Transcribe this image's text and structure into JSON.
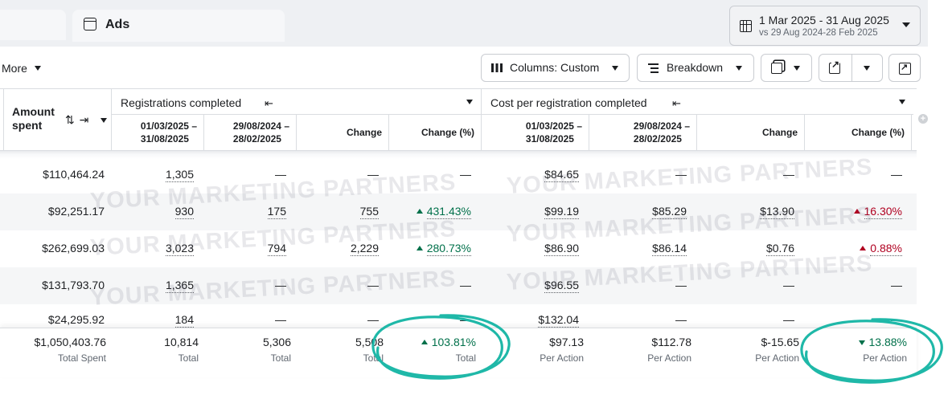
{
  "header": {
    "tab_ads_label": "Ads",
    "date_range": "1 Mar 2025 - 31 Aug 2025",
    "compare_range": "vs 29 Aug 2024-28 Feb 2025"
  },
  "toolbar": {
    "more_label": "More",
    "columns_label": "Columns: Custom",
    "breakdown_label": "Breakdown"
  },
  "table": {
    "amount_header": "Amount spent",
    "amount_sort_icons": "⇅ ⇥",
    "group_registrations": "Registrations completed",
    "group_cost": "Cost per registration completed",
    "sub_current": "01/03/2025 –\n31/08/2025",
    "sub_previous": "29/08/2024 –\n28/02/2025",
    "sub_change": "Change",
    "sub_change_pct": "Change (%)",
    "rows": [
      {
        "amount": "$110,464.24",
        "reg_cur": "1,305",
        "reg_prev": "—",
        "reg_chg": "—",
        "reg_pct": "—",
        "cost_cur": "$84.65",
        "cost_prev": "—",
        "cost_chg": "—",
        "cost_pct": "—"
      },
      {
        "amount": "$92,251.17",
        "reg_cur": "930",
        "reg_prev": "175",
        "reg_chg": "755",
        "reg_pct": "431.43%",
        "cost_cur": "$99.19",
        "cost_prev": "$85.29",
        "cost_chg": "$13.90",
        "cost_pct": "16.30%"
      },
      {
        "amount": "$262,699.03",
        "reg_cur": "3,023",
        "reg_prev": "794",
        "reg_chg": "2,229",
        "reg_pct": "280.73%",
        "cost_cur": "$86.90",
        "cost_prev": "$86.14",
        "cost_chg": "$0.76",
        "cost_pct": "0.88%"
      },
      {
        "amount": "$131,793.70",
        "reg_cur": "1,365",
        "reg_prev": "—",
        "reg_chg": "—",
        "reg_pct": "—",
        "cost_cur": "$96.55",
        "cost_prev": "—",
        "cost_chg": "—",
        "cost_pct": "—"
      },
      {
        "amount": "$24,295.92",
        "reg_cur": "184",
        "reg_prev": "—",
        "reg_chg": "—",
        "reg_pct": "—",
        "cost_cur": "$132.04",
        "cost_prev": "—",
        "cost_chg": "—",
        "cost_pct": "—"
      }
    ],
    "totals": {
      "amount": "$1,050,403.76",
      "amount_label": "Total Spent",
      "reg_cur": "10,814",
      "reg_cur_label": "Total",
      "reg_prev": "5,306",
      "reg_prev_label": "Total",
      "reg_chg": "5,508",
      "reg_chg_label": "Total",
      "reg_pct": "103.81%",
      "reg_pct_label": "Total",
      "cost_cur": "$97.13",
      "cost_cur_label": "Per Action",
      "cost_prev": "$112.78",
      "cost_prev_label": "Per Action",
      "cost_chg": "$-15.65",
      "cost_chg_label": "Per Action",
      "cost_pct": "13.88%",
      "cost_pct_label": "Per Action"
    }
  },
  "watermark": "YOUR MARKETING PARTNERS",
  "colors": {
    "positive": "#00704a",
    "negative": "#b00020",
    "annotation_circle": "#1fb8a8"
  },
  "icons": [
    "table-icon",
    "calendar-icon",
    "columns-icon",
    "breakdown-icon",
    "reports-icon",
    "export-icon",
    "chart-icon",
    "sort-icon",
    "collapse-icon",
    "add-column-icon"
  ]
}
